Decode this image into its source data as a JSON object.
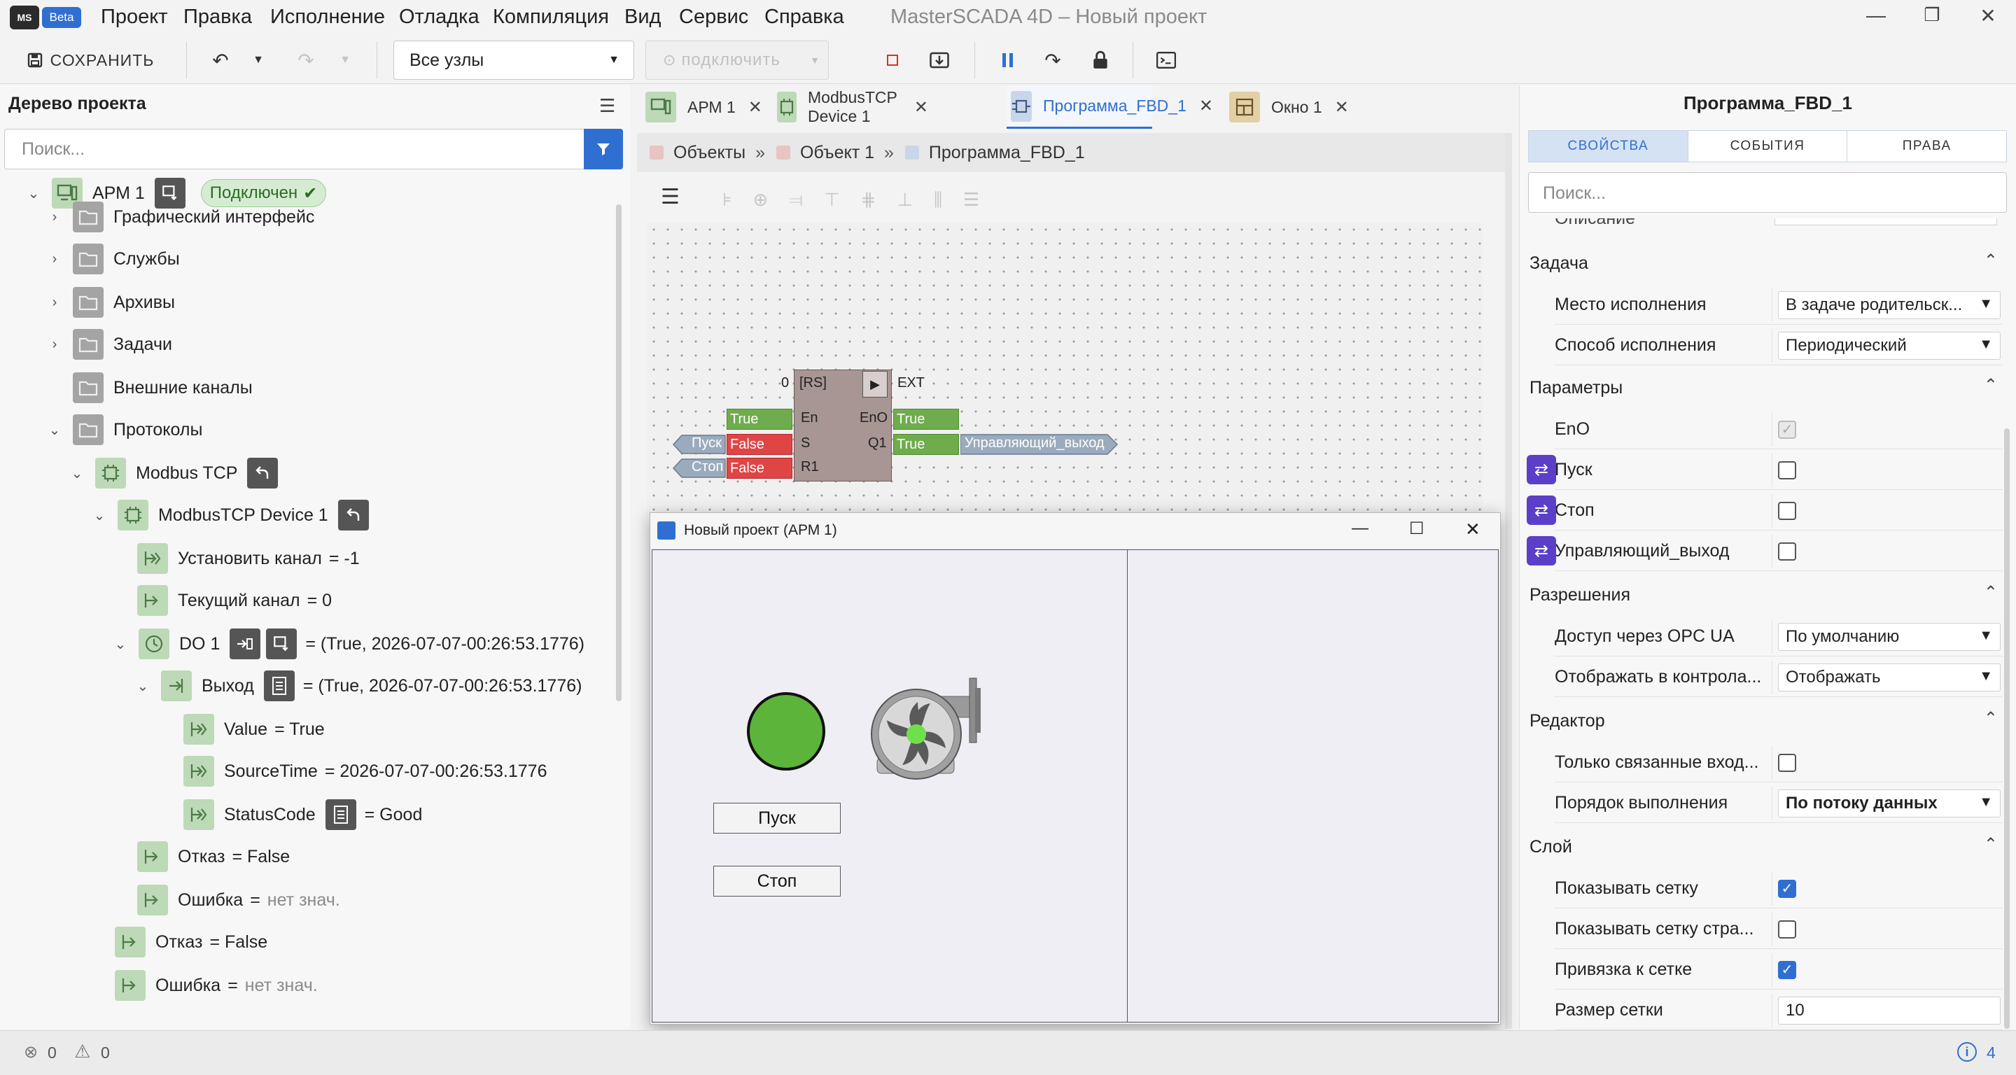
{
  "app": {
    "logo": "MS",
    "beta_label": "Beta",
    "title": "MasterSCADA 4D – Новый проект"
  },
  "menu": [
    "Проект",
    "Правка",
    "Исполнение",
    "Отладка",
    "Компиляция",
    "Вид",
    "Сервис",
    "Справка"
  ],
  "toolbar": {
    "save_label": "СОХРАНИТЬ",
    "nodes_select": "Все узлы",
    "connect_label": "подключить"
  },
  "left": {
    "title": "Дерево проекта",
    "search_placeholder": "Поиск...",
    "tree": {
      "arm": "АРМ 1",
      "arm_status": "Подключен",
      "gui": "Графический интерфейс",
      "services": "Службы",
      "archives": "Архивы",
      "tasks": "Задачи",
      "ext_channels": "Внешние каналы",
      "protocols": "Протоколы",
      "modbus_tcp": "Modbus TCP",
      "device": "ModbusTCP Device 1",
      "set_channel": "Установить канал",
      "set_channel_val": "= -1",
      "cur_channel": "Текущий канал",
      "cur_channel_val": "= 0",
      "do1": "DO 1",
      "do1_val": "= (True, 2026-07-07-00:26:53.1776)",
      "output": "Выход",
      "output_val": "= (True, 2026-07-07-00:26:53.1776)",
      "value": "Value",
      "value_val": "= True",
      "source_time": "SourceTime",
      "source_time_val": "= 2026-07-07-00:26:53.1776",
      "status_code": "StatusCode",
      "status_code_val": "= Good",
      "fail_inner": "Отказ",
      "fail_inner_val": "= False",
      "error_inner": "Ошибка",
      "eq": "=",
      "error_inner_val": "нет знач.",
      "fail_outer": "Отказ",
      "fail_outer_val": "= False",
      "error_outer": "Ошибка",
      "error_outer_val": "нет знач."
    }
  },
  "tabs": [
    {
      "label": "АРМ 1"
    },
    {
      "label": "ModbusTCP Device 1"
    },
    {
      "label": "Программа_FBD_1"
    },
    {
      "label": "Окно 1"
    }
  ],
  "breadcrumb": [
    "Объекты",
    "Объект 1",
    "Программа_FBD_1"
  ],
  "fbd": {
    "block_name": "[RS]",
    "order": "0",
    "ext": "EXT",
    "in_en": "En",
    "in_s": "S",
    "in_r1": "R1",
    "out_eno": "EnO",
    "out_q1": "Q1",
    "val_en": "True",
    "val_s": "False",
    "val_r1": "False",
    "val_eno": "True",
    "val_q1": "True",
    "tag_start": "Пуск",
    "tag_stop": "Стоп",
    "tag_out": "Управляющий_выход"
  },
  "runtime": {
    "title": "Новый проект (АРМ 1)",
    "btn_start": "Пуск",
    "btn_stop": "Стоп",
    "indicator_color": "#5db43a"
  },
  "right": {
    "title": "Программа_FBD_1",
    "tabs": [
      "СВОЙСТВА",
      "СОБЫТИЯ",
      "ПРАВА"
    ],
    "search_placeholder": "Поиск...",
    "cut_label": "Описание",
    "sections": {
      "task": "Задача",
      "params": "Параметры",
      "perms": "Разрешения",
      "editor": "Редактор",
      "layer": "Слой"
    },
    "props": {
      "exec_place": "Место исполнения",
      "exec_place_val": "В задаче родительск...",
      "exec_mode": "Способ исполнения",
      "exec_mode_val": "Периодический",
      "eno": "EnO",
      "start": "Пуск",
      "stop": "Стоп",
      "ctrl_out": "Управляющий_выход",
      "opc_access": "Доступ через OPC UA",
      "opc_access_val": "По умолчанию",
      "show_in_ctrl": "Отображать в контрола...",
      "show_in_ctrl_val": "Отображать",
      "only_linked": "Только связанные вход...",
      "exec_order": "Порядок выполнения",
      "exec_order_val": "По потоку данных",
      "show_grid": "Показывать сетку",
      "show_grid_page": "Показывать сетку стра...",
      "snap_grid": "Привязка к сетке",
      "grid_size": "Размер сетки",
      "grid_size_val": "10"
    }
  },
  "status": {
    "errors": "0",
    "warnings": "0",
    "info": "4"
  }
}
